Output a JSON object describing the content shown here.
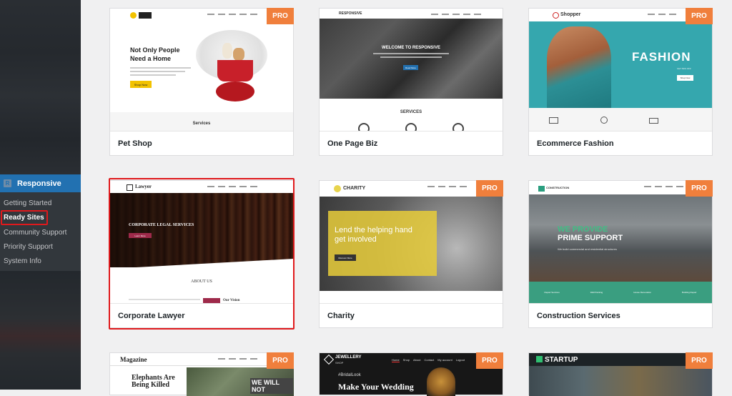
{
  "sidebar": {
    "menu_label": "Responsive",
    "items": [
      {
        "label": "Getting Started"
      },
      {
        "label": "Ready Sites"
      },
      {
        "label": "Community Support"
      },
      {
        "label": "Priority Support"
      },
      {
        "label": "System Info"
      }
    ]
  },
  "badge": "PRO",
  "cards": [
    {
      "title": "Pet Shop",
      "thumb": {
        "heading": "Not Only People Need a Home",
        "section": "Services",
        "button": "Shop Now"
      }
    },
    {
      "title": "One Page Biz",
      "thumb": {
        "logo": "RESPONSIVE",
        "heading": "WELCOME TO RESPONSIVE",
        "section": "SERVICES",
        "button": "Read More"
      }
    },
    {
      "title": "Ecommerce Fashion",
      "thumb": {
        "logo": "Shopper",
        "heading": "FASHION",
        "sub": "GET 50% OFF",
        "button": "Shop Now"
      }
    },
    {
      "title": "Corporate Lawyer",
      "thumb": {
        "logo": "Lawyer",
        "heading": "CORPORATE LEGAL SERVICES",
        "section": "ABOUT US",
        "extra": "Our Vision",
        "button": "Learn More"
      }
    },
    {
      "title": "Charity",
      "thumb": {
        "logo": "CHARITY",
        "heading": "Lend the helping hand get involved",
        "button": "Discover More"
      }
    },
    {
      "title": "Construction Services",
      "thumb": {
        "logo": "CONSTRUCTION",
        "heading1": "WE PROVIDE",
        "heading2": "PRIME SUPPORT",
        "sub": "We build commercial and residential structures",
        "strip": [
          "Repair Services",
          "Wall Painting",
          "House Renovation",
          "Building Repair"
        ]
      }
    },
    {
      "title": "",
      "thumb": {
        "logo": "Magazine",
        "heading": "Elephants Are Being Killed",
        "photo_text": "WE WILL NOT"
      }
    },
    {
      "title": "",
      "thumb": {
        "logo": "JEWELLERY",
        "logo_sub": "SHOP",
        "tag": "#BridalLook",
        "heading": "Make Your Wedding",
        "nav": [
          "Home",
          "Shop",
          "About",
          "Contact",
          "My account",
          "Logout"
        ]
      }
    },
    {
      "title": "",
      "thumb": {
        "logo": "STARTUP"
      }
    }
  ],
  "colors": {
    "sidebar_bg": "#23282d",
    "active_menu": "#2271b1",
    "pro_badge": "#f07f3c",
    "highlight": "#e0191c"
  }
}
